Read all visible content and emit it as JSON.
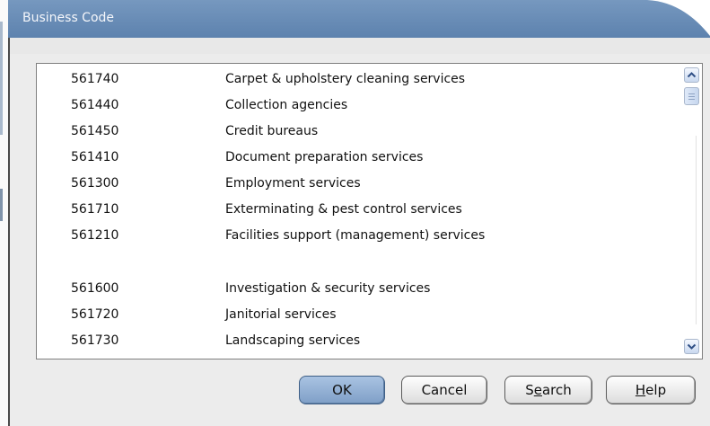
{
  "window": {
    "title": "Business Code"
  },
  "rows": [
    {
      "code": "561740",
      "desc": "Carpet & upholstery cleaning services"
    },
    {
      "code": "561440",
      "desc": "Collection agencies"
    },
    {
      "code": "561450",
      "desc": "Credit bureaus"
    },
    {
      "code": "561410",
      "desc": "Document preparation services"
    },
    {
      "code": "561300",
      "desc": "Employment services"
    },
    {
      "code": "561710",
      "desc": "Exterminating & pest control services"
    },
    {
      "code": "561210",
      "desc": "Facilities support (management) services"
    },
    {
      "code": "561600",
      "desc": "Investigation & security services"
    },
    {
      "code": "561720",
      "desc": "Janitorial services"
    },
    {
      "code": "561730",
      "desc": "Landscaping services"
    }
  ],
  "buttons": {
    "ok": "OK",
    "cancel": "Cancel",
    "search_pre": "S",
    "search_u": "e",
    "search_post": "arch",
    "help_u": "H",
    "help_post": "elp"
  },
  "colors": {
    "titlebar": "#6a8cb7",
    "primary_button": "#94b2d8"
  },
  "icons": {
    "scroll_up": "chevron-up-icon",
    "scroll_down": "chevron-down-icon"
  }
}
